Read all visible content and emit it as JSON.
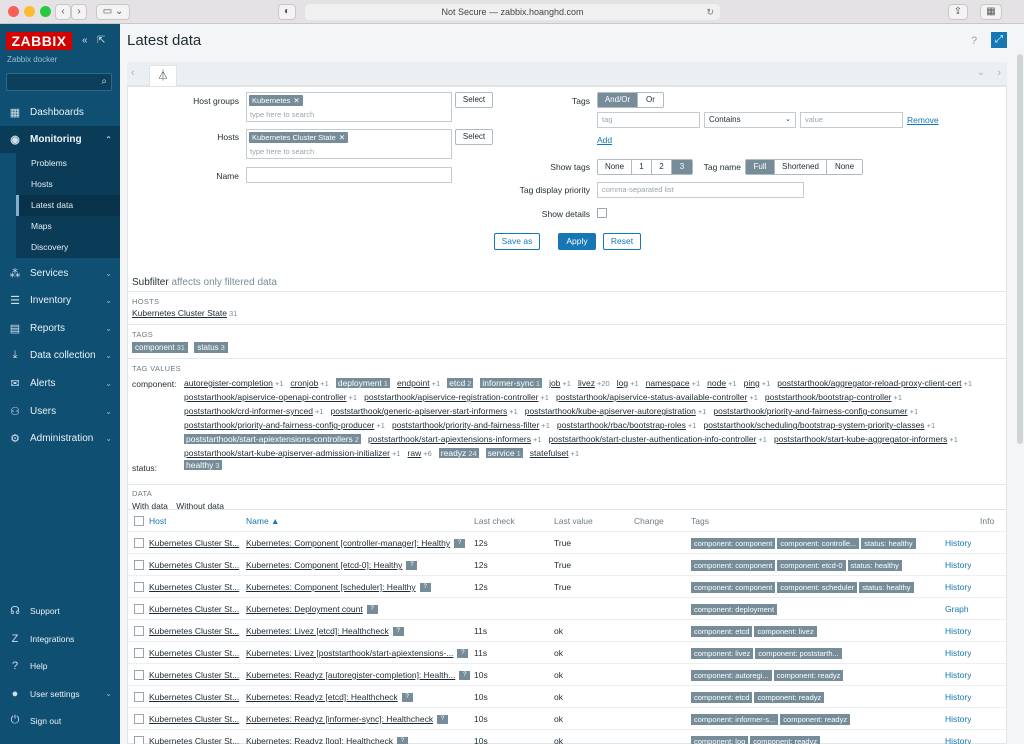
{
  "browser": {
    "url": "Not Secure — zabbix.hoanghd.com"
  },
  "sidebar": {
    "logo": "ZABBIX",
    "subtitle": "Zabbix docker",
    "nav": [
      {
        "label": "Dashboards",
        "icon": "dashboard-icon"
      },
      {
        "label": "Monitoring",
        "icon": "eye-icon"
      },
      {
        "label": "Services",
        "icon": "services-icon"
      },
      {
        "label": "Inventory",
        "icon": "inventory-icon"
      },
      {
        "label": "Reports",
        "icon": "reports-icon"
      },
      {
        "label": "Data collection",
        "icon": "download-icon"
      },
      {
        "label": "Alerts",
        "icon": "envelope-icon"
      },
      {
        "label": "Users",
        "icon": "users-icon"
      },
      {
        "label": "Administration",
        "icon": "gear-icon"
      }
    ],
    "monitoring_sub": [
      "Problems",
      "Hosts",
      "Latest data",
      "Maps",
      "Discovery"
    ],
    "bottom": [
      "Support",
      "Integrations",
      "Help",
      "User settings",
      "Sign out"
    ]
  },
  "page": {
    "title": "Latest data"
  },
  "filter": {
    "host_groups_label": "Host groups",
    "host_groups_chip": "Kubernetes",
    "hosts_label": "Hosts",
    "hosts_chip": "Kubernetes Cluster State",
    "placeholder": "type here to search",
    "select_label": "Select",
    "name_label": "Name",
    "tags_label": "Tags",
    "and_or": "And/Or",
    "or": "Or",
    "tag_placeholder": "tag",
    "contains": "Contains",
    "value_placeholder": "value",
    "remove": "Remove",
    "add": "Add",
    "show_tags_label": "Show tags",
    "show_tags_options": [
      "None",
      "1",
      "2",
      "3"
    ],
    "tag_name_label": "Tag name",
    "tag_name_options": [
      "Full",
      "Shortened",
      "None"
    ],
    "tag_priority_label": "Tag display priority",
    "tag_priority_placeholder": "comma-separated list",
    "show_details_label": "Show details",
    "save_as": "Save as",
    "apply": "Apply",
    "reset": "Reset"
  },
  "subfilter": {
    "title": "Subfilter",
    "note": "affects only filtered data",
    "hosts_header": "HOSTS",
    "host_item": "Kubernetes Cluster State",
    "host_count": "31",
    "tags_header": "TAGS",
    "tags": [
      {
        "name": "component",
        "count": "31"
      },
      {
        "name": "status",
        "count": "3"
      }
    ],
    "tag_values_header": "TAG VALUES",
    "component_label": "component:",
    "status_label": "status:",
    "tag_value_lines": [
      [
        {
          "t": "autoregister-completion",
          "c": "+1"
        },
        {
          "t": "cronjob",
          "c": "+1"
        },
        {
          "t": "deployment",
          "c": "1",
          "on": true
        },
        {
          "t": "endpoint",
          "c": "+1"
        },
        {
          "t": "etcd",
          "c": "2",
          "on": true
        },
        {
          "t": "informer-sync",
          "c": "1",
          "on": true
        },
        {
          "t": "job",
          "c": "+1"
        },
        {
          "t": "livez",
          "c": "+20"
        },
        {
          "t": "log",
          "c": "+1"
        },
        {
          "t": "namespace",
          "c": "+1"
        },
        {
          "t": "node",
          "c": "+1"
        },
        {
          "t": "ping",
          "c": "+1"
        },
        {
          "t": "poststarthook/aggregator-reload-proxy-client-cert",
          "c": "+1"
        }
      ],
      [
        {
          "t": "poststarthook/apiservice-openapi-controller",
          "c": "+1"
        },
        {
          "t": "poststarthook/apiservice-registration-controller",
          "c": "+1"
        },
        {
          "t": "poststarthook/apiservice-status-available-controller",
          "c": "+1"
        },
        {
          "t": "poststarthook/bootstrap-controller",
          "c": "+1"
        }
      ],
      [
        {
          "t": "poststarthook/crd-informer-synced",
          "c": "+1"
        },
        {
          "t": "poststarthook/generic-apiserver-start-informers",
          "c": "+1"
        },
        {
          "t": "poststarthook/kube-apiserver-autoregistration",
          "c": "+1"
        },
        {
          "t": "poststarthook/priority-and-fairness-config-consumer",
          "c": "+1"
        }
      ],
      [
        {
          "t": "poststarthook/priority-and-fairness-config-producer",
          "c": "+1"
        },
        {
          "t": "poststarthook/priority-and-fairness-filter",
          "c": "+1"
        },
        {
          "t": "poststarthook/rbac/bootstrap-roles",
          "c": "+1"
        },
        {
          "t": "poststarthook/scheduling/bootstrap-system-priority-classes",
          "c": "+1"
        }
      ],
      [
        {
          "t": "poststarthook/start-apiextensions-controllers",
          "c": "2",
          "on": true
        },
        {
          "t": "poststarthook/start-apiextensions-informers",
          "c": "+1"
        },
        {
          "t": "poststarthook/start-cluster-authentication-info-controller",
          "c": "+1"
        },
        {
          "t": "poststarthook/start-kube-aggregator-informers",
          "c": "+1"
        }
      ],
      [
        {
          "t": "poststarthook/start-kube-apiserver-admission-initializer",
          "c": "+1"
        },
        {
          "t": "raw",
          "c": "+6"
        },
        {
          "t": "readyz",
          "c": "24",
          "on": true
        },
        {
          "t": "service",
          "c": "1",
          "on": true
        },
        {
          "t": "statefulset",
          "c": "+1"
        }
      ]
    ],
    "status_value": {
      "t": "healthy",
      "c": "3"
    },
    "data_header": "DATA",
    "data_options": [
      "With data",
      "Without data"
    ]
  },
  "table": {
    "headers": {
      "host": "Host",
      "name": "Name ▲",
      "last_check": "Last check",
      "last_value": "Last value",
      "change": "Change",
      "tags": "Tags",
      "info": "Info"
    },
    "rows": [
      {
        "host": "Kubernetes Cluster St...",
        "name": "Kubernetes: Component [controller-manager]: Healthy",
        "check": "12s",
        "value": "True",
        "tags": [
          "component: component",
          "component: controlle...",
          "status: healthy"
        ],
        "action": "History"
      },
      {
        "host": "Kubernetes Cluster St...",
        "name": "Kubernetes: Component [etcd-0]: Healthy",
        "check": "12s",
        "value": "True",
        "tags": [
          "component: component",
          "component: etcd-0",
          "status: healthy"
        ],
        "action": "History"
      },
      {
        "host": "Kubernetes Cluster St...",
        "name": "Kubernetes: Component [scheduler]: Healthy",
        "check": "12s",
        "value": "True",
        "tags": [
          "component: component",
          "component: scheduler",
          "status: healthy"
        ],
        "action": "History"
      },
      {
        "host": "Kubernetes Cluster St...",
        "name": "Kubernetes: Deployment count",
        "check": "",
        "value": "",
        "tags": [
          "component: deployment"
        ],
        "action": "Graph"
      },
      {
        "host": "Kubernetes Cluster St...",
        "name": "Kubernetes: Livez [etcd]: Healthcheck",
        "check": "11s",
        "value": "ok",
        "tags": [
          "component: etcd",
          "component: livez"
        ],
        "action": "History"
      },
      {
        "host": "Kubernetes Cluster St...",
        "name": "Kubernetes: Livez [poststarthook/start-apiextensions-...",
        "check": "11s",
        "value": "ok",
        "tags": [
          "component: livez",
          "component: poststarth..."
        ],
        "action": "History"
      },
      {
        "host": "Kubernetes Cluster St...",
        "name": "Kubernetes: Readyz [autoregister-completion]: Health...",
        "check": "10s",
        "value": "ok",
        "tags": [
          "component: autoregi...",
          "component: readyz"
        ],
        "action": "History"
      },
      {
        "host": "Kubernetes Cluster St...",
        "name": "Kubernetes: Readyz [etcd]: Healthcheck",
        "check": "10s",
        "value": "ok",
        "tags": [
          "component: etcd",
          "component: readyz"
        ],
        "action": "History"
      },
      {
        "host": "Kubernetes Cluster St...",
        "name": "Kubernetes: Readyz [informer-sync]: Healthcheck",
        "check": "10s",
        "value": "ok",
        "tags": [
          "component: informer-s...",
          "component: readyz"
        ],
        "action": "History"
      },
      {
        "host": "Kubernetes Cluster St...",
        "name": "Kubernetes: Readyz [log]: Healthcheck",
        "check": "10s",
        "value": "ok",
        "tags": [
          "component: log",
          "component: readyz"
        ],
        "action": "History"
      }
    ]
  },
  "colors": {
    "sidebar": "#0e4f72",
    "accent": "#1577b4",
    "tag": "#768d99",
    "logo": "#d40000"
  }
}
